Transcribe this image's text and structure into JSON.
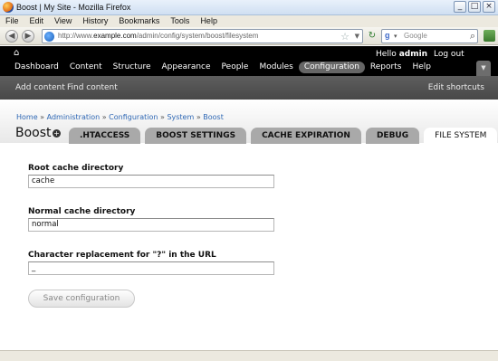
{
  "window": {
    "title": "Boost | My Site - Mozilla Firefox",
    "controls": [
      "_",
      "□",
      "×"
    ]
  },
  "menubar": [
    "File",
    "Edit",
    "View",
    "History",
    "Bookmarks",
    "Tools",
    "Help"
  ],
  "navigation": {
    "url_prefix": "http://www.",
    "url_domain": "example.com",
    "url_path": "/admin/config/system/boost/filesystem",
    "search_engine_icon": "g",
    "search_placeholder": "Google"
  },
  "toolbar": {
    "hello_label": "Hello",
    "username": "admin",
    "logout_label": "Log out",
    "menu": [
      {
        "label": "Dashboard",
        "active": false
      },
      {
        "label": "Content",
        "active": false
      },
      {
        "label": "Structure",
        "active": false
      },
      {
        "label": "Appearance",
        "active": false
      },
      {
        "label": "People",
        "active": false
      },
      {
        "label": "Modules",
        "active": false
      },
      {
        "label": "Configuration",
        "active": true
      },
      {
        "label": "Reports",
        "active": false
      },
      {
        "label": "Help",
        "active": false
      }
    ]
  },
  "shortcuts": {
    "add_content": "Add content",
    "find_content": "Find content",
    "edit_shortcuts": "Edit shortcuts"
  },
  "breadcrumb": [
    "Home",
    "Administration",
    "Configuration",
    "System",
    "Boost"
  ],
  "breadcrumb_separator": "»",
  "page": {
    "title": "Boost",
    "shortcut_icon": "+"
  },
  "tabs": [
    {
      "label": ".HTACCESS",
      "active": false
    },
    {
      "label": "BOOST SETTINGS",
      "active": false
    },
    {
      "label": "CACHE EXPIRATION",
      "active": false
    },
    {
      "label": "DEBUG",
      "active": false
    },
    {
      "label": "FILE SYSTEM",
      "active": true
    }
  ],
  "form": {
    "root_cache": {
      "label": "Root cache directory",
      "value": "cache"
    },
    "normal_cache": {
      "label": "Normal cache directory",
      "value": "normal"
    },
    "char_replacement": {
      "label": "Character replacement for \"?\" in the URL",
      "value": "_"
    },
    "save_label": "Save configuration"
  }
}
